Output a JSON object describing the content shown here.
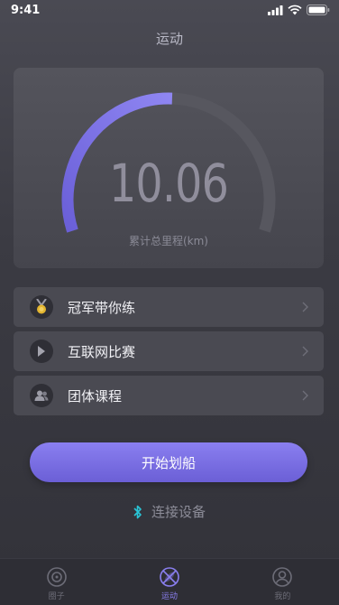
{
  "status_bar": {
    "time": "9:41"
  },
  "header": {
    "title": "运动"
  },
  "gauge": {
    "value": "10.06",
    "label": "累计总里程(km)",
    "fill_fraction": 0.5
  },
  "menu": [
    {
      "label": "冠军带你练",
      "icon": "medal-icon"
    },
    {
      "label": "互联网比赛",
      "icon": "play-icon"
    },
    {
      "label": "团体课程",
      "icon": "group-icon"
    }
  ],
  "start_button": {
    "label": "开始划船"
  },
  "connect": {
    "label": "连接设备",
    "icon": "bluetooth-icon"
  },
  "tabs": [
    {
      "label": "圈子",
      "icon": "circle-icon",
      "active": false
    },
    {
      "label": "运动",
      "icon": "rowing-icon",
      "active": true
    },
    {
      "label": "我的",
      "icon": "profile-icon",
      "active": false
    }
  ],
  "colors": {
    "accent": "#7b6fe6",
    "accent_light": "#8a7ff0",
    "bluetooth": "#29c4d6"
  }
}
